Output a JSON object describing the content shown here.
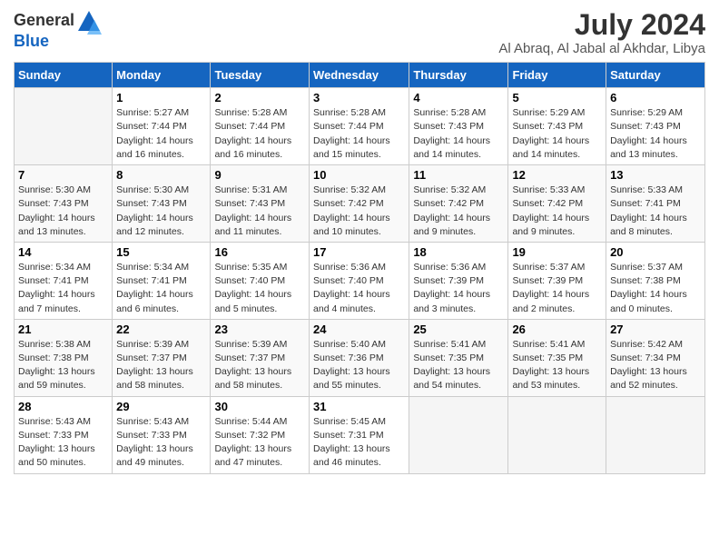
{
  "logo": {
    "text_general": "General",
    "text_blue": "Blue"
  },
  "title": {
    "month_year": "July 2024",
    "location": "Al Abraq, Al Jabal al Akhdar, Libya"
  },
  "headers": [
    "Sunday",
    "Monday",
    "Tuesday",
    "Wednesday",
    "Thursday",
    "Friday",
    "Saturday"
  ],
  "weeks": [
    [
      {
        "day": "",
        "info": ""
      },
      {
        "day": "1",
        "info": "Sunrise: 5:27 AM\nSunset: 7:44 PM\nDaylight: 14 hours\nand 16 minutes."
      },
      {
        "day": "2",
        "info": "Sunrise: 5:28 AM\nSunset: 7:44 PM\nDaylight: 14 hours\nand 16 minutes."
      },
      {
        "day": "3",
        "info": "Sunrise: 5:28 AM\nSunset: 7:44 PM\nDaylight: 14 hours\nand 15 minutes."
      },
      {
        "day": "4",
        "info": "Sunrise: 5:28 AM\nSunset: 7:43 PM\nDaylight: 14 hours\nand 14 minutes."
      },
      {
        "day": "5",
        "info": "Sunrise: 5:29 AM\nSunset: 7:43 PM\nDaylight: 14 hours\nand 14 minutes."
      },
      {
        "day": "6",
        "info": "Sunrise: 5:29 AM\nSunset: 7:43 PM\nDaylight: 14 hours\nand 13 minutes."
      }
    ],
    [
      {
        "day": "7",
        "info": "Sunrise: 5:30 AM\nSunset: 7:43 PM\nDaylight: 14 hours\nand 13 minutes."
      },
      {
        "day": "8",
        "info": "Sunrise: 5:30 AM\nSunset: 7:43 PM\nDaylight: 14 hours\nand 12 minutes."
      },
      {
        "day": "9",
        "info": "Sunrise: 5:31 AM\nSunset: 7:43 PM\nDaylight: 14 hours\nand 11 minutes."
      },
      {
        "day": "10",
        "info": "Sunrise: 5:32 AM\nSunset: 7:42 PM\nDaylight: 14 hours\nand 10 minutes."
      },
      {
        "day": "11",
        "info": "Sunrise: 5:32 AM\nSunset: 7:42 PM\nDaylight: 14 hours\nand 9 minutes."
      },
      {
        "day": "12",
        "info": "Sunrise: 5:33 AM\nSunset: 7:42 PM\nDaylight: 14 hours\nand 9 minutes."
      },
      {
        "day": "13",
        "info": "Sunrise: 5:33 AM\nSunset: 7:41 PM\nDaylight: 14 hours\nand 8 minutes."
      }
    ],
    [
      {
        "day": "14",
        "info": "Sunrise: 5:34 AM\nSunset: 7:41 PM\nDaylight: 14 hours\nand 7 minutes."
      },
      {
        "day": "15",
        "info": "Sunrise: 5:34 AM\nSunset: 7:41 PM\nDaylight: 14 hours\nand 6 minutes."
      },
      {
        "day": "16",
        "info": "Sunrise: 5:35 AM\nSunset: 7:40 PM\nDaylight: 14 hours\nand 5 minutes."
      },
      {
        "day": "17",
        "info": "Sunrise: 5:36 AM\nSunset: 7:40 PM\nDaylight: 14 hours\nand 4 minutes."
      },
      {
        "day": "18",
        "info": "Sunrise: 5:36 AM\nSunset: 7:39 PM\nDaylight: 14 hours\nand 3 minutes."
      },
      {
        "day": "19",
        "info": "Sunrise: 5:37 AM\nSunset: 7:39 PM\nDaylight: 14 hours\nand 2 minutes."
      },
      {
        "day": "20",
        "info": "Sunrise: 5:37 AM\nSunset: 7:38 PM\nDaylight: 14 hours\nand 0 minutes."
      }
    ],
    [
      {
        "day": "21",
        "info": "Sunrise: 5:38 AM\nSunset: 7:38 PM\nDaylight: 13 hours\nand 59 minutes."
      },
      {
        "day": "22",
        "info": "Sunrise: 5:39 AM\nSunset: 7:37 PM\nDaylight: 13 hours\nand 58 minutes."
      },
      {
        "day": "23",
        "info": "Sunrise: 5:39 AM\nSunset: 7:37 PM\nDaylight: 13 hours\nand 58 minutes."
      },
      {
        "day": "24",
        "info": "Sunrise: 5:40 AM\nSunset: 7:36 PM\nDaylight: 13 hours\nand 55 minutes."
      },
      {
        "day": "25",
        "info": "Sunrise: 5:41 AM\nSunset: 7:35 PM\nDaylight: 13 hours\nand 54 minutes."
      },
      {
        "day": "26",
        "info": "Sunrise: 5:41 AM\nSunset: 7:35 PM\nDaylight: 13 hours\nand 53 minutes."
      },
      {
        "day": "27",
        "info": "Sunrise: 5:42 AM\nSunset: 7:34 PM\nDaylight: 13 hours\nand 52 minutes."
      }
    ],
    [
      {
        "day": "28",
        "info": "Sunrise: 5:43 AM\nSunset: 7:33 PM\nDaylight: 13 hours\nand 50 minutes."
      },
      {
        "day": "29",
        "info": "Sunrise: 5:43 AM\nSunset: 7:33 PM\nDaylight: 13 hours\nand 49 minutes."
      },
      {
        "day": "30",
        "info": "Sunrise: 5:44 AM\nSunset: 7:32 PM\nDaylight: 13 hours\nand 47 minutes."
      },
      {
        "day": "31",
        "info": "Sunrise: 5:45 AM\nSunset: 7:31 PM\nDaylight: 13 hours\nand 46 minutes."
      },
      {
        "day": "",
        "info": ""
      },
      {
        "day": "",
        "info": ""
      },
      {
        "day": "",
        "info": ""
      }
    ]
  ]
}
